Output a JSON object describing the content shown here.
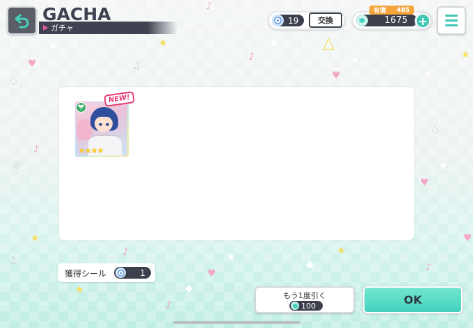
{
  "header": {
    "title": "GACHA",
    "subtitle": "ガチャ"
  },
  "currency": {
    "exchange_count": "19",
    "exchange_label": "交換",
    "paid_label": "有償",
    "paid_count": "485",
    "gem_count": "1675"
  },
  "result": {
    "new_label": "NEW!",
    "card": {
      "rarity_stars": 4,
      "attribute": "cute-leaf",
      "frame": "rainbow"
    }
  },
  "seal": {
    "label": "獲得シール",
    "count": "1"
  },
  "actions": {
    "again_label": "もう1度引く",
    "again_cost": "100",
    "ok_label": "OK"
  },
  "colors": {
    "accent": "#43d2bd",
    "dark": "#3c404c",
    "new_badge": "#e63b73",
    "paid_tag": "#f5a53b"
  }
}
